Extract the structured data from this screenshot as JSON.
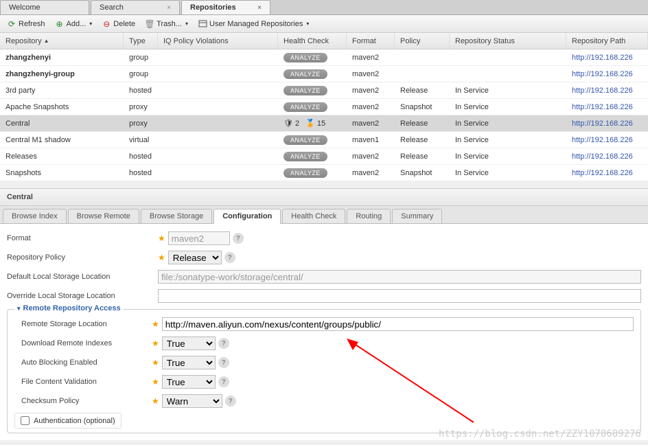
{
  "topTabs": [
    {
      "label": "Welcome",
      "closable": false
    },
    {
      "label": "Search",
      "closable": true
    },
    {
      "label": "Repositories",
      "closable": true,
      "active": true
    }
  ],
  "toolbar": {
    "refresh": "Refresh",
    "add": "Add...",
    "delete": "Delete",
    "trash": "Trash...",
    "userManaged": "User Managed Repositories"
  },
  "columns": {
    "repository": "Repository",
    "type": "Type",
    "iq": "IQ Policy Violations",
    "health": "Health Check",
    "format": "Format",
    "policy": "Policy",
    "status": "Repository Status",
    "path": "Repository Path"
  },
  "rows": [
    {
      "repo": "zhangzhenyi",
      "bold": true,
      "type": "group",
      "health": "analyze",
      "format": "maven2",
      "policy": "",
      "status": "",
      "path": "http://192.168.226"
    },
    {
      "repo": "zhangzhenyi-group",
      "bold": true,
      "type": "group",
      "health": "analyze",
      "format": "maven2",
      "policy": "",
      "status": "",
      "path": "http://192.168.226"
    },
    {
      "repo": "3rd party",
      "type": "hosted",
      "health": "analyze",
      "format": "maven2",
      "policy": "Release",
      "status": "In Service",
      "path": "http://192.168.226"
    },
    {
      "repo": "Apache Snapshots",
      "type": "proxy",
      "health": "analyze",
      "format": "maven2",
      "policy": "Snapshot",
      "status": "In Service",
      "path": "http://192.168.226"
    },
    {
      "repo": "Central",
      "type": "proxy",
      "health": "icons",
      "healthShield": "2",
      "healthMedal": "15",
      "format": "maven2",
      "policy": "Release",
      "status": "In Service",
      "path": "http://192.168.226",
      "selected": true
    },
    {
      "repo": "Central M1 shadow",
      "type": "virtual",
      "health": "analyze",
      "format": "maven1",
      "policy": "Release",
      "status": "In Service",
      "path": "http://192.168.226"
    },
    {
      "repo": "Releases",
      "type": "hosted",
      "health": "analyze",
      "format": "maven2",
      "policy": "Release",
      "status": "In Service",
      "path": "http://192.168.226"
    },
    {
      "repo": "Snapshots",
      "type": "hosted",
      "health": "analyze",
      "format": "maven2",
      "policy": "Snapshot",
      "status": "In Service",
      "path": "http://192.168.226"
    }
  ],
  "analyzeLabel": "ANALYZE",
  "detailTitle": "Central",
  "detailTabs": [
    "Browse Index",
    "Browse Remote",
    "Browse Storage",
    "Configuration",
    "Health Check",
    "Routing",
    "Summary"
  ],
  "detailActiveTab": "Configuration",
  "form": {
    "formatLabel": "Format",
    "formatValue": "maven2",
    "policyLabel": "Repository Policy",
    "policyValue": "Release",
    "defaultStorageLabel": "Default Local Storage Location",
    "defaultStorageValue": "file:/sonatype-work/storage/central/",
    "overrideStorageLabel": "Override Local Storage Location",
    "overrideStorageValue": "",
    "remoteSectionTitle": "Remote Repository Access",
    "remoteLocationLabel": "Remote Storage Location",
    "remoteLocationValue": "http://maven.aliyun.com/nexus/content/groups/public/",
    "downloadIndexesLabel": "Download Remote Indexes",
    "downloadIndexesValue": "True",
    "autoBlockingLabel": "Auto Blocking Enabled",
    "autoBlockingValue": "True",
    "fileValidationLabel": "File Content Validation",
    "fileValidationValue": "True",
    "checksumLabel": "Checksum Policy",
    "checksumValue": "Warn",
    "authLabel": "Authentication (optional)"
  },
  "watermark": "https://blog.csdn.net/ZZY1078689276"
}
